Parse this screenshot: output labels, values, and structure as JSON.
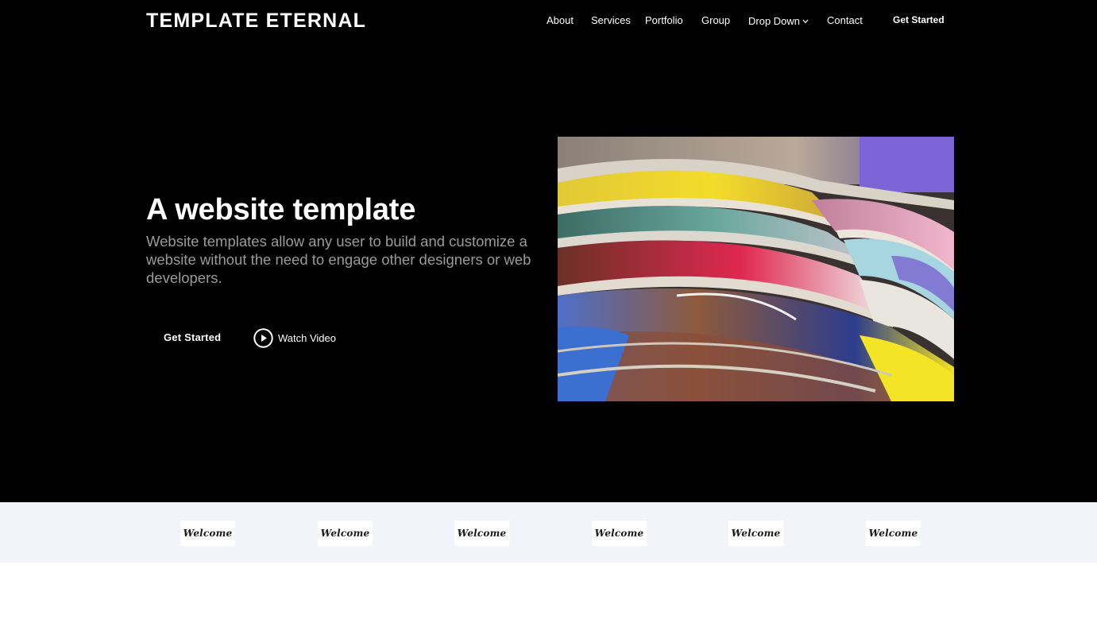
{
  "brand": {
    "logo_text": "TEMPLATE ETERNAL"
  },
  "nav": {
    "items": [
      {
        "label": "About"
      },
      {
        "label": "Services"
      },
      {
        "label": "Portfolio"
      },
      {
        "label": "Group"
      },
      {
        "label": "Drop Down",
        "icon": "chevron-down-icon"
      },
      {
        "label": "Contact"
      }
    ],
    "cta_label": "Get Started"
  },
  "hero": {
    "title": "A website template",
    "subtitle": "Website templates allow any user to build and customize a website without the need to engage other designers or web developers.",
    "primary_button_label": "Get Started",
    "video_button_label": "Watch Video",
    "video_button_icon": "play-circle-icon",
    "image_description_icon": "magazines-image"
  },
  "clients": {
    "logos": [
      {
        "text": "Welcome"
      },
      {
        "text": "Welcome"
      },
      {
        "text": "Welcome"
      },
      {
        "text": "Welcome"
      },
      {
        "text": "Welcome"
      },
      {
        "text": "Welcome"
      }
    ]
  },
  "colors": {
    "hero_background": "#000000",
    "text_primary": "#ffffff",
    "text_muted": "#9a9a9a",
    "clients_background": "#f3f3fa"
  }
}
